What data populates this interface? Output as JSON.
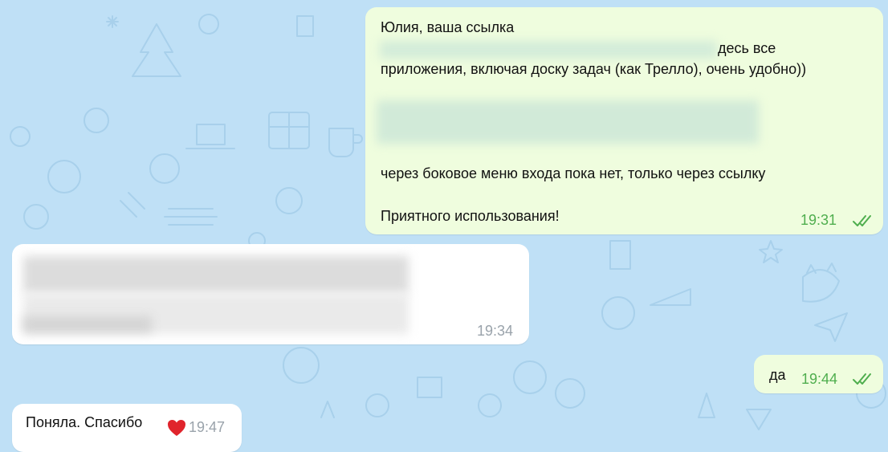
{
  "chat": {
    "messages": [
      {
        "direction": "outgoing",
        "lines": [
          "Юлия, ваша ссылка",
          "десь все",
          "приложения, включая доску задач (как Трелло), очень удобно))",
          "через боковое меню входа пока нет, только через ссылку",
          "Приятного использования!"
        ],
        "time": "19:31",
        "status": "read-double-check"
      },
      {
        "direction": "incoming",
        "time": "19:34"
      },
      {
        "direction": "outgoing",
        "text": "да",
        "time": "19:44",
        "status": "read-double-check"
      },
      {
        "direction": "incoming",
        "text": "Поняла. Спасибо",
        "reaction": "red-heart",
        "time": "19:47"
      }
    ]
  },
  "colors": {
    "background": "#bfe0f6",
    "outgoing_bubble": "#effdde",
    "incoming_bubble": "#ffffff",
    "outgoing_time": "#4fae4e",
    "incoming_time": "#9aa3ab",
    "reaction_heart": "#e0242c"
  }
}
